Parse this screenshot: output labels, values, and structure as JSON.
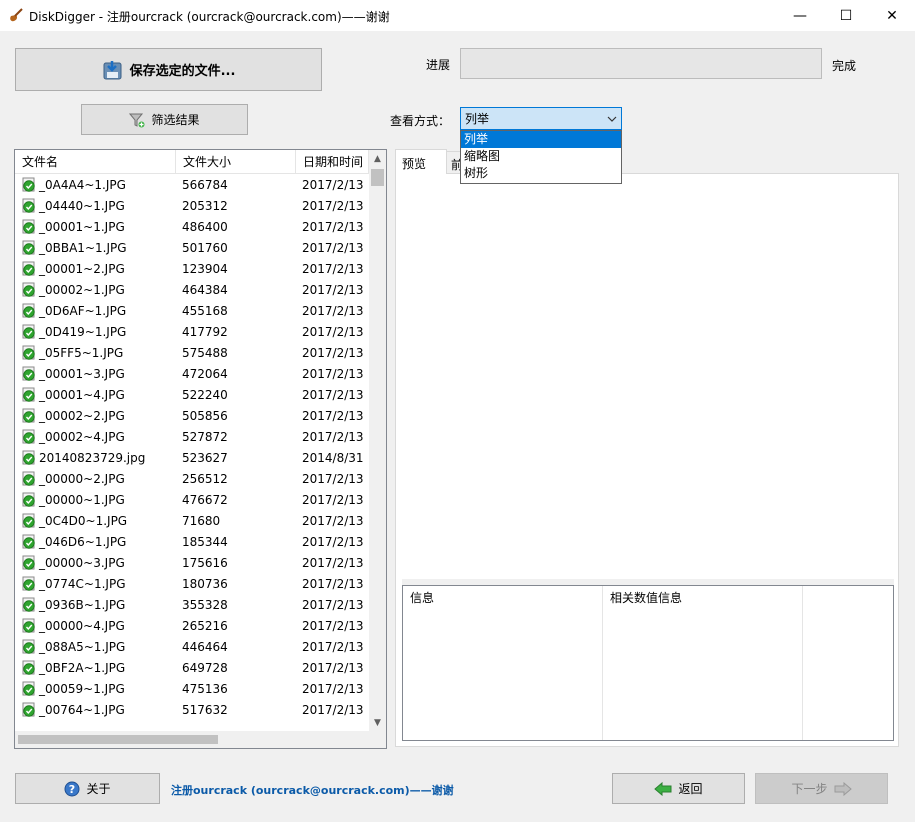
{
  "window": {
    "title": "DiskDigger - 注册ourcrack (ourcrack@ourcrack.com)——谢谢",
    "min_glyph": "—",
    "max_glyph": "☐",
    "close_glyph": "✕"
  },
  "toolbar": {
    "save_label": "保存选定的文件...",
    "filter_label": "筛选结果"
  },
  "progress": {
    "label": "进展",
    "value": 0,
    "done_label": "完成"
  },
  "view": {
    "label": "查看方式：",
    "selected": "列举",
    "options": [
      "列举",
      "缩略图",
      "树形"
    ]
  },
  "file_list": {
    "columns": [
      "文件名",
      "文件大小",
      "日期和时间"
    ],
    "rows": [
      {
        "name": "_0A4A4~1.JPG",
        "size": "566784",
        "date": "2017/2/13"
      },
      {
        "name": "_04440~1.JPG",
        "size": "205312",
        "date": "2017/2/13"
      },
      {
        "name": "_00001~1.JPG",
        "size": "486400",
        "date": "2017/2/13"
      },
      {
        "name": "_0BBA1~1.JPG",
        "size": "501760",
        "date": "2017/2/13"
      },
      {
        "name": "_00001~2.JPG",
        "size": "123904",
        "date": "2017/2/13"
      },
      {
        "name": "_00002~1.JPG",
        "size": "464384",
        "date": "2017/2/13"
      },
      {
        "name": "_0D6AF~1.JPG",
        "size": "455168",
        "date": "2017/2/13"
      },
      {
        "name": "_0D419~1.JPG",
        "size": "417792",
        "date": "2017/2/13"
      },
      {
        "name": "_05FF5~1.JPG",
        "size": "575488",
        "date": "2017/2/13"
      },
      {
        "name": "_00001~3.JPG",
        "size": "472064",
        "date": "2017/2/13"
      },
      {
        "name": "_00001~4.JPG",
        "size": "522240",
        "date": "2017/2/13"
      },
      {
        "name": "_00002~2.JPG",
        "size": "505856",
        "date": "2017/2/13"
      },
      {
        "name": "_00002~4.JPG",
        "size": "527872",
        "date": "2017/2/13"
      },
      {
        "name": "20140823729.jpg",
        "size": "523627",
        "date": "2014/8/31"
      },
      {
        "name": "_00000~2.JPG",
        "size": "256512",
        "date": "2017/2/13"
      },
      {
        "name": "_00000~1.JPG",
        "size": "476672",
        "date": "2017/2/13"
      },
      {
        "name": "_0C4D0~1.JPG",
        "size": "71680",
        "date": "2017/2/13"
      },
      {
        "name": "_046D6~1.JPG",
        "size": "185344",
        "date": "2017/2/13"
      },
      {
        "name": "_00000~3.JPG",
        "size": "175616",
        "date": "2017/2/13"
      },
      {
        "name": "_0774C~1.JPG",
        "size": "180736",
        "date": "2017/2/13"
      },
      {
        "name": "_0936B~1.JPG",
        "size": "355328",
        "date": "2017/2/13"
      },
      {
        "name": "_00000~4.JPG",
        "size": "265216",
        "date": "2017/2/13"
      },
      {
        "name": "_088A5~1.JPG",
        "size": "446464",
        "date": "2017/2/13"
      },
      {
        "name": "_0BF2A~1.JPG",
        "size": "649728",
        "date": "2017/2/13"
      },
      {
        "name": "_00059~1.JPG",
        "size": "475136",
        "date": "2017/2/13"
      },
      {
        "name": "_00764~1.JPG",
        "size": "517632",
        "date": "2017/2/13"
      }
    ]
  },
  "tabs": {
    "preview": "预览",
    "other": "前"
  },
  "info_table": {
    "columns": [
      "信息",
      "相关数值信息"
    ]
  },
  "footer": {
    "about_label": "关于",
    "register_text": "注册ourcrack (ourcrack@ourcrack.com)——谢谢",
    "back_label": "返回",
    "next_label": "下一步"
  },
  "colors": {
    "accent": "#0078d7",
    "link": "#0b5aa8",
    "file_icon": "#2fa52f"
  }
}
